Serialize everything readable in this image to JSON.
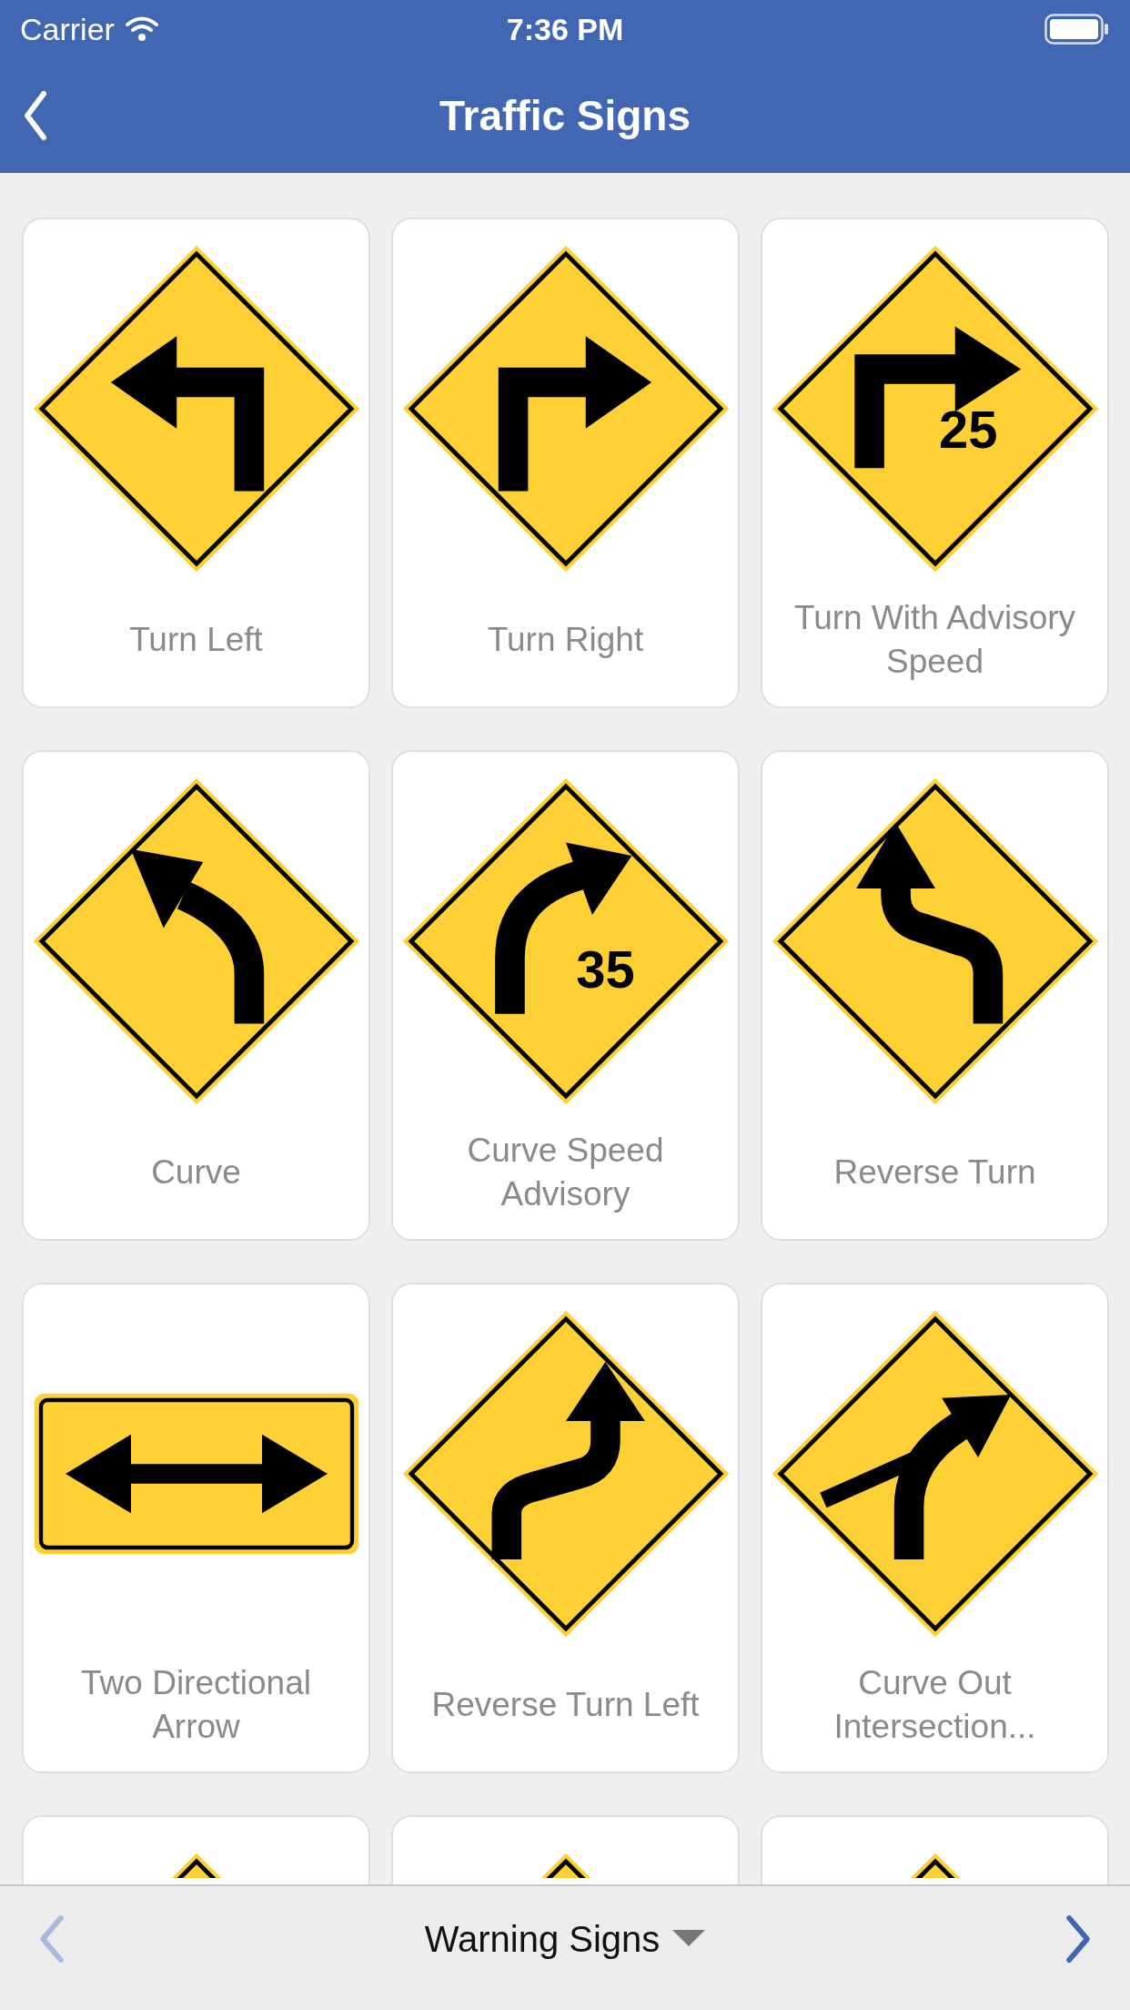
{
  "status_bar": {
    "carrier": "Carrier",
    "time": "7:36 PM"
  },
  "nav": {
    "title": "Traffic Signs"
  },
  "signs": [
    {
      "kind": "leftturn",
      "label": "Turn Left"
    },
    {
      "kind": "rightturn",
      "label": "Turn Right"
    },
    {
      "kind": "advisoryturn",
      "speed": "25",
      "label": "Turn With Advisory Speed"
    },
    {
      "kind": "leftcurve",
      "label": "Curve"
    },
    {
      "kind": "advisorycurve",
      "speed": "35",
      "label": "Curve Speed Advisory"
    },
    {
      "kind": "reverseturn",
      "label": "Reverse Turn"
    },
    {
      "kind": "doublearrow",
      "label": "Two Directional Arrow"
    },
    {
      "kind": "reversecurve",
      "label": "Reverse Turn Left"
    },
    {
      "kind": "curveout",
      "label": "Curve Out Intersection..."
    },
    {
      "kind": "diamondtop"
    },
    {
      "kind": "diamondtop"
    },
    {
      "kind": "diamondtop"
    }
  ],
  "bottom_bar": {
    "category": "Warning Signs",
    "prev_disabled": true,
    "next_disabled": false
  }
}
